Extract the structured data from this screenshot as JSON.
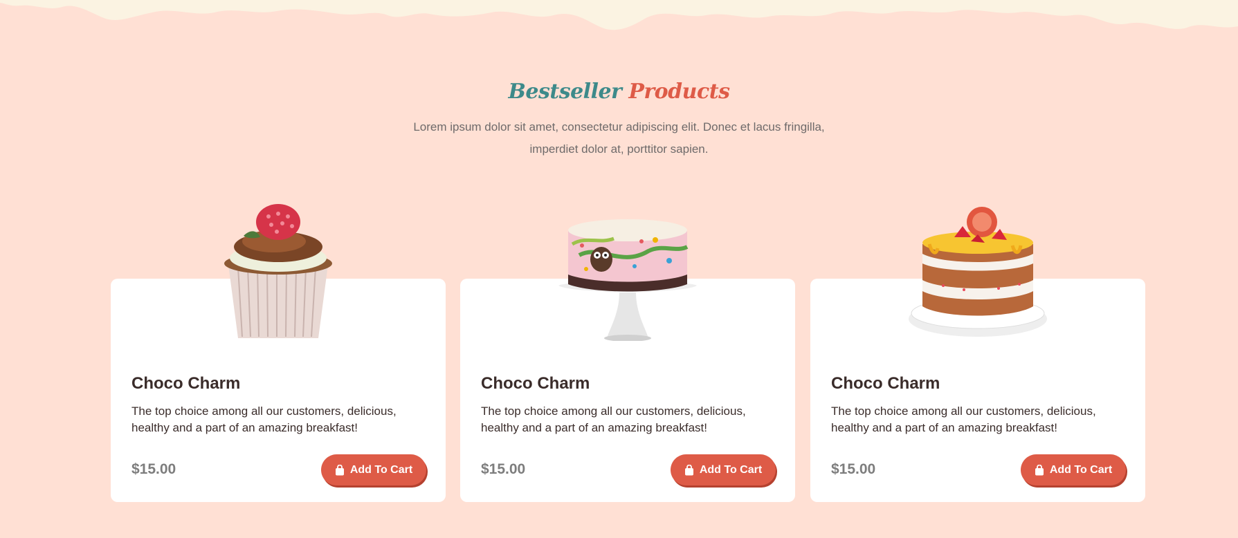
{
  "section": {
    "title_word1": "Bestseller",
    "title_word2": "Products",
    "subtitle": "Lorem ipsum dolor sit amet, consectetur adipiscing elit. Donec et lacus fringilla, imperdiet dolor at, porttitor sapien."
  },
  "colors": {
    "background": "#ffe0d4",
    "accent": "#de5b47",
    "teal": "#3d8a8a",
    "card": "#ffffff"
  },
  "products": [
    {
      "image": "raspberry-cupcake",
      "title": "Choco Charm",
      "description": "The top choice among all our customers, delicious, healthy and a part of an amazing breakfast!",
      "price": "$15.00",
      "button_label": "Add To Cart",
      "button_icon": "shopping-bag-icon"
    },
    {
      "image": "owl-cake-on-stand",
      "title": "Choco Charm",
      "description": "The top choice among all our customers, delicious, healthy and a part of an amazing breakfast!",
      "price": "$15.00",
      "button_label": "Add To Cart",
      "button_icon": "shopping-bag-icon"
    },
    {
      "image": "fruit-layer-cake",
      "title": "Choco Charm",
      "description": "The top choice among all our customers, delicious, healthy and a part of an amazing breakfast!",
      "price": "$15.00",
      "button_label": "Add To Cart",
      "button_icon": "shopping-bag-icon"
    }
  ]
}
